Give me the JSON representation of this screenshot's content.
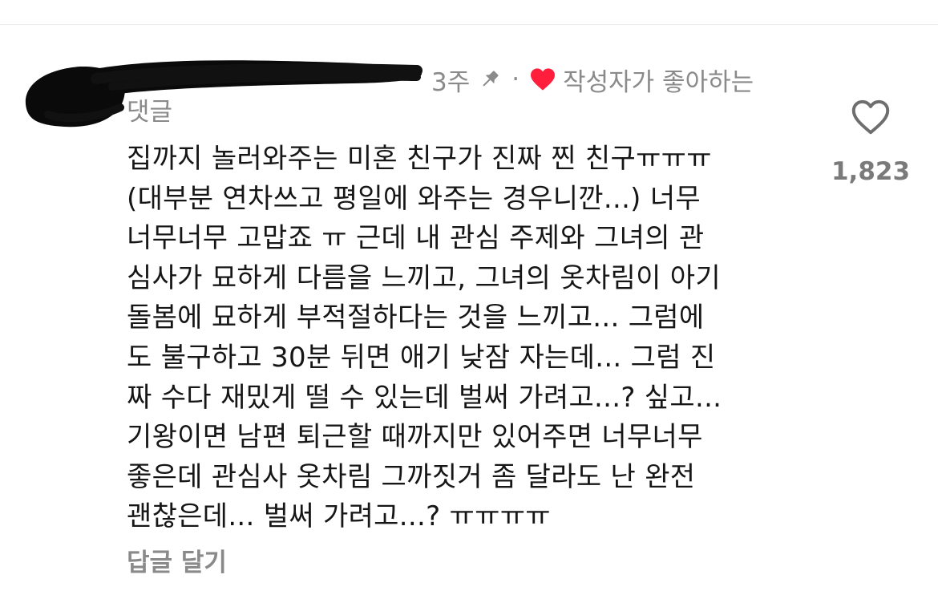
{
  "comment": {
    "time_ago": "3주",
    "meta_separator": "·",
    "author_liked_label_part1": "작성자가 좋아하는",
    "author_liked_label_part2": "댓글",
    "body_lines": [
      "집까지 놀러와주는 미혼 친구가 진짜 찐 친구ㅠㅠㅠ",
      "(대부분 연차쓰고 평일에 와주는 경우니깐...) 너무",
      "너무너무 고맙죠 ㅠ 근데 내 관심 주제와 그녀의 관",
      "심사가 묘하게 다름을 느끼고, 그녀의 옷차림이 아기",
      "돌봄에 묘하게 부적절하다는 것을 느끼고... 그럼에",
      "도 불구하고 30분 뒤면 애기 낮잠 자는데... 그럼 진",
      "짜 수다 재밌게 떨 수 있는데 벌써 가려고...? 싶고...",
      "기왕이면 남편 퇴근할 때까지만 있어주면 너무너무",
      "좋은데 관심사 옷차림 그까짓거 좀 달라도 난 완전",
      "괜찮은데... 벌써 가려고...? ㅠㅠㅠㅠ"
    ],
    "like_count": "1,823",
    "reply_label": "답글 달기"
  },
  "icons": {
    "pin": "pin-icon",
    "author_heart": "heart-icon",
    "like": "heart-outline-icon"
  },
  "colors": {
    "author_heart": "#ff1f3d",
    "meta_text": "#8a8a8a",
    "body_text": "#161616"
  }
}
